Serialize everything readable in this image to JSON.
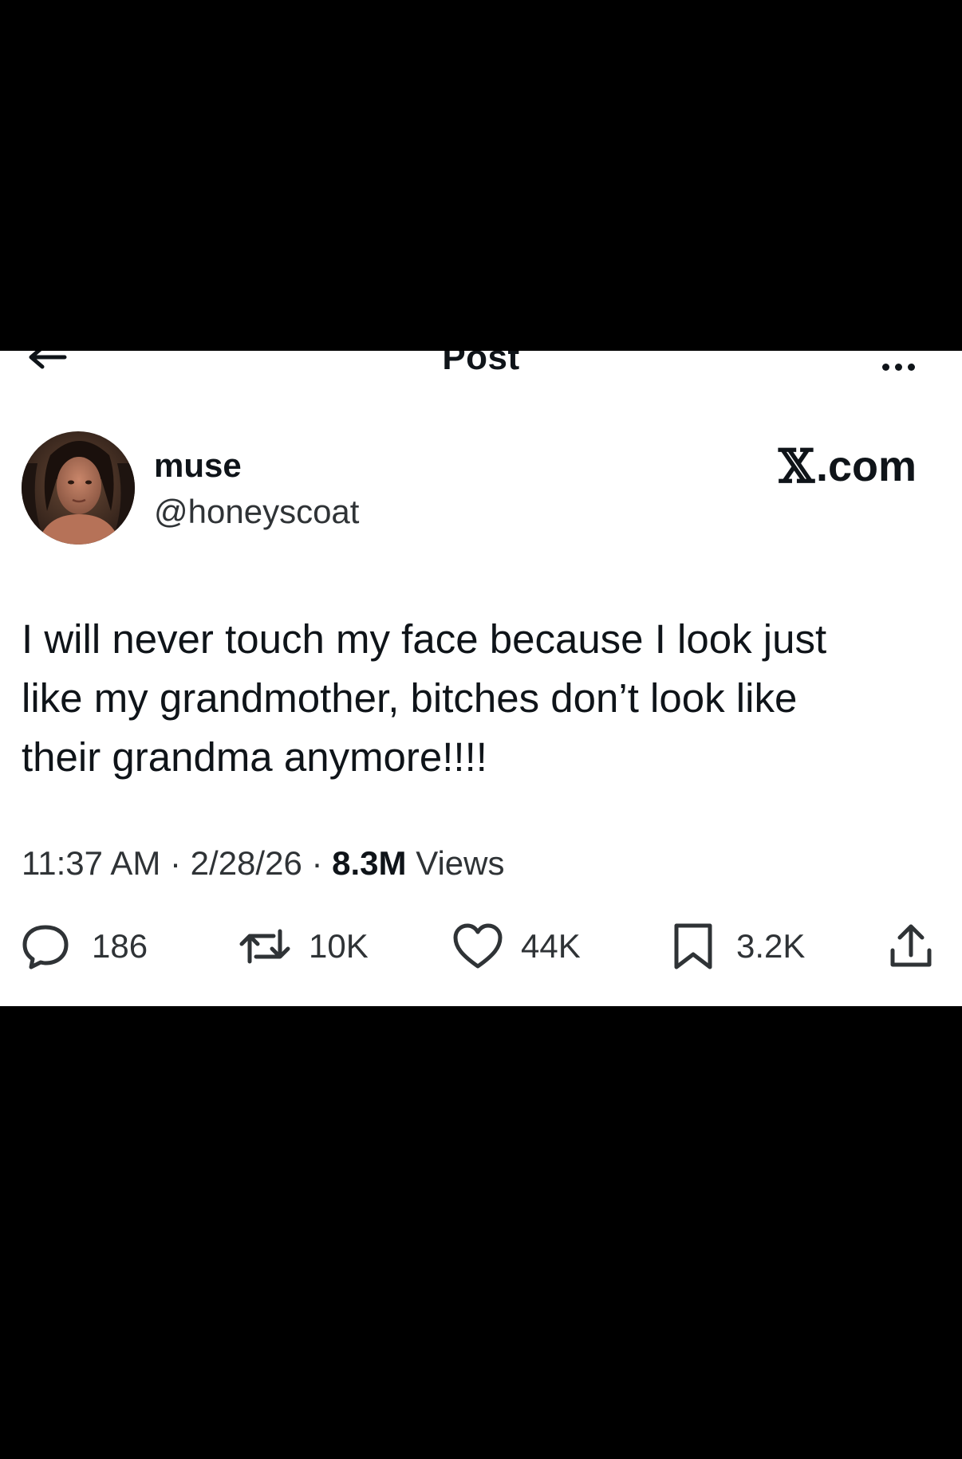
{
  "header": {
    "title": "Post"
  },
  "post": {
    "author": {
      "display_name": "muse",
      "handle": "@honeyscoat"
    },
    "brand": {
      "mark": "𝕏",
      "suffix": ".com"
    },
    "text": "I will never touch my face because I look just\nlike my grandmother, bitches don’t look like\ntheir grandma anymore!!!!",
    "time": "11:37 AM",
    "date": "2/28/26",
    "views_count": "8.3M",
    "views_label": "Views"
  },
  "actions": {
    "replies": "186",
    "reposts": "10K",
    "likes": "44K",
    "bookmarks": "3.2K"
  },
  "icons": {
    "back": "back-arrow-icon",
    "more": "more-icon",
    "reply": "reply-icon",
    "repost": "repost-icon",
    "like": "heart-icon",
    "bookmark": "bookmark-icon",
    "share": "share-icon"
  },
  "colors": {
    "background": "#ffffff",
    "text": "#0f1419",
    "secondary_text": "#2f3336",
    "letterbox": "#000000"
  }
}
